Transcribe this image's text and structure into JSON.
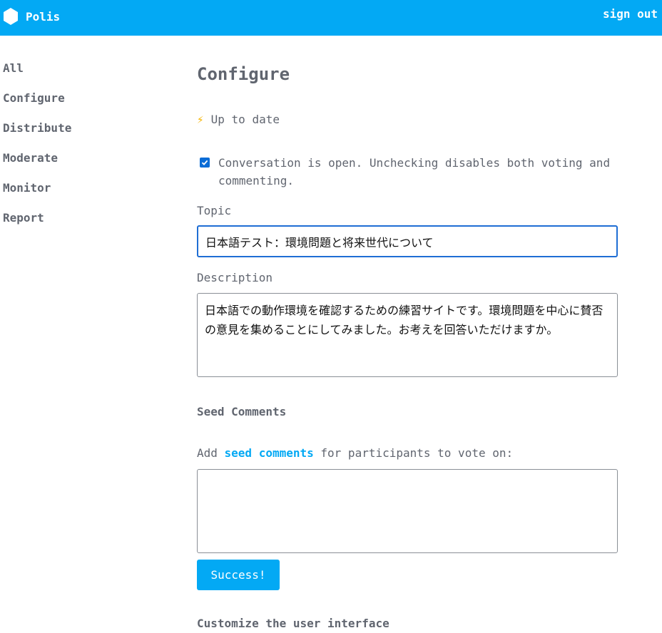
{
  "header": {
    "brand": "Polis",
    "sign_out": "sign out"
  },
  "sidebar": {
    "items": [
      {
        "label": "All"
      },
      {
        "label": "Configure"
      },
      {
        "label": "Distribute"
      },
      {
        "label": "Moderate"
      },
      {
        "label": "Monitor"
      },
      {
        "label": "Report"
      }
    ]
  },
  "main": {
    "title": "Configure",
    "status": "Up to date",
    "open_checkbox": {
      "checked": true,
      "label": "Conversation is open. Unchecking disables both voting and commenting."
    },
    "topic": {
      "label": "Topic",
      "value": "日本語テスト：環境問題と将来世代について"
    },
    "description": {
      "label": "Description",
      "value": "日本語での動作環境を確認するための練習サイトです。環境問題を中心に賛否の意見を集めることにしてみました。お考えを回答いただけますか。"
    },
    "seed": {
      "heading": "Seed Comments",
      "help_prefix": "Add ",
      "help_link": "seed comments",
      "help_suffix": " for participants to vote on:",
      "value": ""
    },
    "submit_label": "Success!",
    "customize_heading": "Customize the user interface"
  },
  "colors": {
    "accent": "#03a9f4",
    "checkbox": "#0a6cd6",
    "focus_border": "#1f6ed4",
    "text": "#60656f"
  },
  "icons": {
    "logo": "hexagon-logo-icon",
    "status": "lightning-bolt-icon",
    "checkbox": "checkmark-icon"
  }
}
